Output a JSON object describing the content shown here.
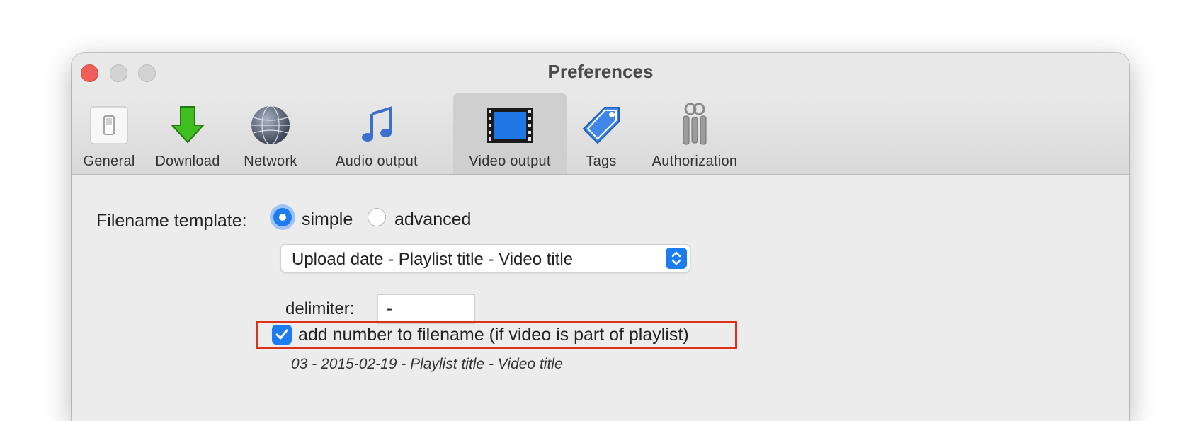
{
  "window": {
    "title": "Preferences"
  },
  "toolbar": {
    "items": [
      {
        "label": "General",
        "icon": "switch-icon"
      },
      {
        "label": "Download",
        "icon": "download-arrow-icon"
      },
      {
        "label": "Network",
        "icon": "globe-icon"
      },
      {
        "label": "Audio output",
        "icon": "music-note-icon"
      },
      {
        "label": "Video output",
        "icon": "film-strip-icon",
        "selected": true
      },
      {
        "label": "Tags",
        "icon": "tag-icon"
      },
      {
        "label": "Authorization",
        "icon": "keys-icon"
      }
    ]
  },
  "filename": {
    "label": "Filename template:",
    "options": [
      {
        "label": "simple",
        "selected": true
      },
      {
        "label": "advanced",
        "selected": false
      }
    ],
    "template_select_value": "Upload date - Playlist title - Video title",
    "delimiter_label": "delimiter:",
    "delimiter_value": "-",
    "add_number_label": "add number to filename (if video is part of playlist)",
    "add_number_checked": true,
    "example": "03 - 2015-02-19 - Playlist title - Video title"
  },
  "colors": {
    "accent": "#1e7cf2",
    "highlight": "#d9331a",
    "close": "#ee5f57"
  }
}
